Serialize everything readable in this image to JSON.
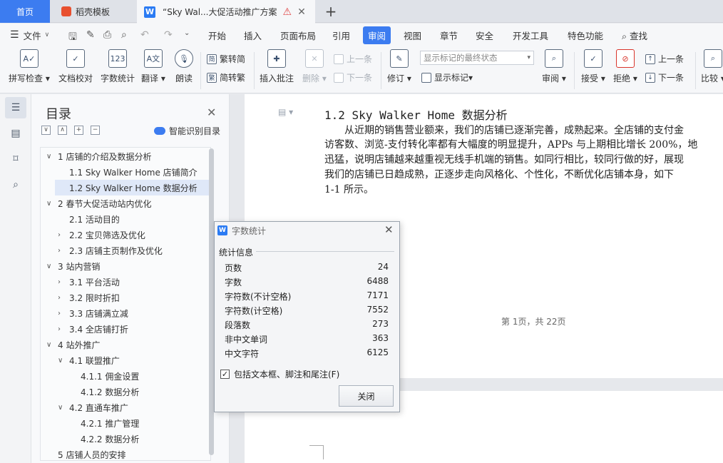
{
  "tabs": {
    "home": "首页",
    "template": "稻壳模板",
    "document": "“Sky Wal...大促活动推广方案",
    "add": "+"
  },
  "menu": {
    "file": "文件",
    "items": [
      "开始",
      "插入",
      "页面布局",
      "引用",
      "审阅",
      "视图",
      "章节",
      "安全",
      "开发工具",
      "特色功能"
    ],
    "active": "审阅",
    "search": "查找"
  },
  "ribbon": {
    "spellcheck": "拼写检查",
    "proofread": "文档校对",
    "wordcount": "字数统计",
    "translate": "翻译",
    "read_aloud": "朗读",
    "trad": "繁转简",
    "simp": "简转繁",
    "insert_comment": "插入批注",
    "delete": "删除",
    "prev": "上一条",
    "next": "下一条",
    "revise": "修订",
    "markup_state": "显示标记的最终状态",
    "show_markup": "显示标记",
    "review": "审阅",
    "accept": "接受",
    "reject": "拒绝",
    "prev2": "上一条",
    "next2": "下一条",
    "compare": "比较"
  },
  "toc": {
    "title": "目录",
    "smart": "智能识别目录",
    "items": [
      {
        "label": "1 店铺的介绍及数据分析",
        "level": 1,
        "chev": "∨"
      },
      {
        "label": "1.1 Sky Walker Home 店铺简介",
        "level": 2,
        "chev": ""
      },
      {
        "label": "1.2 Sky Walker Home 数据分析",
        "level": 2,
        "chev": "",
        "selected": true
      },
      {
        "label": "2 春节大促活动站内优化",
        "level": 1,
        "chev": "∨"
      },
      {
        "label": "2.1 活动目的",
        "level": 2,
        "chev": ""
      },
      {
        "label": "2.2 宝贝筛选及优化",
        "level": 2,
        "chev": "›"
      },
      {
        "label": "2.3 店铺主页制作及优化",
        "level": 2,
        "chev": "›"
      },
      {
        "label": "3 站内营销",
        "level": 1,
        "chev": "∨"
      },
      {
        "label": "3.1 平台活动",
        "level": 2,
        "chev": "›"
      },
      {
        "label": "3.2 限时折扣",
        "level": 2,
        "chev": "›"
      },
      {
        "label": "3.3 店铺满立减",
        "level": 2,
        "chev": "›"
      },
      {
        "label": "3.4 全店铺打折",
        "level": 2,
        "chev": "›"
      },
      {
        "label": "4 站外推广",
        "level": 1,
        "chev": "∨"
      },
      {
        "label": "4.1 联盟推广",
        "level": 2,
        "chev": "∨"
      },
      {
        "label": "4.1.1  佣金设置",
        "level": 3,
        "chev": ""
      },
      {
        "label": "4.1.2  数据分析",
        "level": 3,
        "chev": ""
      },
      {
        "label": "4.2 直通车推广",
        "level": 2,
        "chev": "∨"
      },
      {
        "label": "4.2.1 推广管理",
        "level": 3,
        "chev": ""
      },
      {
        "label": "4.2.2 数据分析",
        "level": 3,
        "chev": ""
      },
      {
        "label": "5 店铺人员的安排",
        "level": 1,
        "chev": ""
      }
    ]
  },
  "document": {
    "heading": "1.2 Sky Walker Home 数据分析",
    "lines": [
      "　　从近期的销售营业额来，我们的店铺已逐渐完善，成熟起来。全店铺的支付金",
      "访客数、浏览-支付转化率都有大幅度的明显提升，APPs 与上期相比增长 200%，地",
      "迅猛，说明店铺越来越重视无线手机端的销售。如同行相比，较同行做的好，展现",
      "我们的店铺已日趋成熟，正逐步走向风格化、个性化，不断优化店铺本身，如下",
      "1-1 所示。"
    ],
    "page_footer": "第 1页，共 22页"
  },
  "dialog": {
    "title": "字数统计",
    "group": "统计信息",
    "stats": [
      {
        "k": "页数",
        "v": "24"
      },
      {
        "k": "字数",
        "v": "6488"
      },
      {
        "k": "字符数(不计空格)",
        "v": "7171"
      },
      {
        "k": "字符数(计空格)",
        "v": "7552"
      },
      {
        "k": "段落数",
        "v": "273"
      },
      {
        "k": "非中文单词",
        "v": "363"
      },
      {
        "k": "中文字符",
        "v": "6125"
      }
    ],
    "checkbox": "包括文本框、脚注和尾注(F)",
    "close": "关闭"
  }
}
